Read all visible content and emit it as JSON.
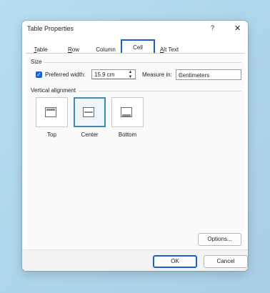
{
  "dialog": {
    "title": "Table Properties",
    "help_glyph": "?",
    "close_glyph": "✕"
  },
  "tabs": [
    {
      "label": "Table",
      "mnemonic": "T",
      "rest": "able",
      "active": false
    },
    {
      "label": "Row",
      "mnemonic": "R",
      "rest": "ow",
      "active": false
    },
    {
      "label": "Column",
      "mnemonic": "",
      "rest": "Column",
      "active": false
    },
    {
      "label": "Cell",
      "mnemonic": "",
      "rest": "Cell",
      "active": true
    },
    {
      "label": "Alt Text",
      "mnemonic": "A",
      "rest": "lt Text",
      "active": false
    }
  ],
  "size": {
    "section_label": "Size",
    "preferred_width_checked": true,
    "preferred_width_label": "Preferred width:",
    "preferred_width_value": "15.9 cm",
    "measure_in_label": "Measure in:",
    "measure_in_value": "Centimeters"
  },
  "vertical_alignment": {
    "section_label": "Vertical alignment",
    "options": [
      {
        "label": "Top",
        "selected": false
      },
      {
        "label": "Center",
        "selected": true
      },
      {
        "label": "Bottom",
        "selected": false
      }
    ]
  },
  "buttons": {
    "options": "Options...",
    "ok": "OK",
    "cancel": "Cancel"
  },
  "colors": {
    "accent": "#1a5fd6",
    "selected_border": "#3d8bb4"
  }
}
